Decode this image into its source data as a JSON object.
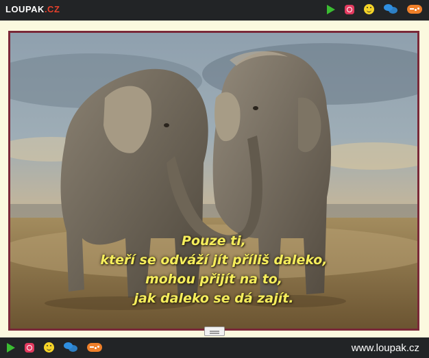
{
  "header": {
    "logo_main": "LOUPAK",
    "logo_suffix": ".CZ",
    "icons": [
      "play-icon",
      "instagram-icon",
      "smiley-icon",
      "chat-icon",
      "gamepad-icon"
    ]
  },
  "content": {
    "image_alt": "Two elephants with intertwined trunks",
    "quote_lines": [
      "Pouze ti,",
      "kteří se odváží jít příliš daleko,",
      "mohou přijít na to,",
      "jak daleko se dá zajít."
    ]
  },
  "footer": {
    "site": "www.loupak.cz",
    "icons": [
      "play-icon",
      "instagram-icon",
      "smiley-icon",
      "chat-icon",
      "gamepad-icon"
    ]
  },
  "colors": {
    "bar": "#222426",
    "page_bg": "#fbf9df",
    "frame": "#7a2838",
    "quote_text": "#f6ee5c",
    "logo_accent": "#e8412c"
  }
}
